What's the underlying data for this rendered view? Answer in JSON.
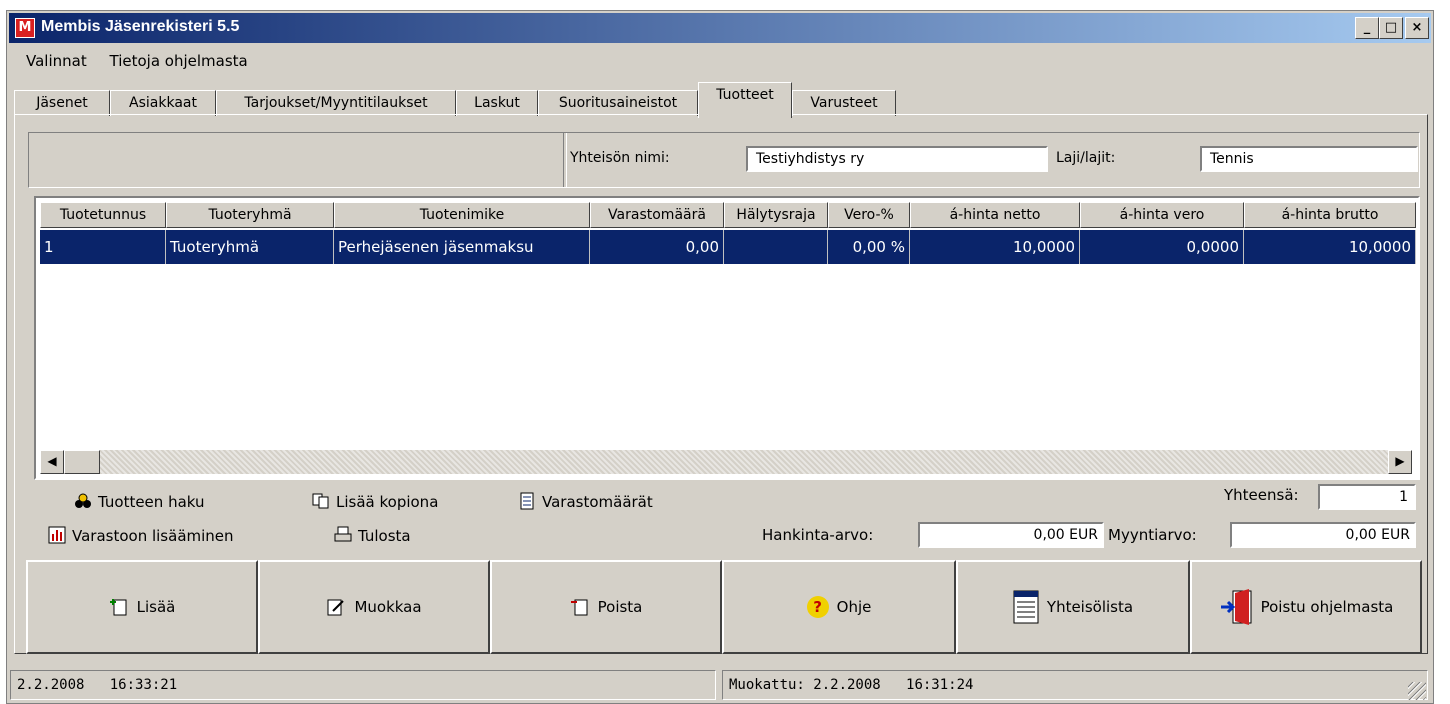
{
  "window": {
    "title": "Membis Jäsenrekisteri 5.5",
    "icon_letter": "M",
    "controls": [
      "_",
      "□",
      "×"
    ]
  },
  "menu": [
    "Valinnat",
    "Tietoja ohjelmasta"
  ],
  "tabs": [
    {
      "label": "Jäsenet"
    },
    {
      "label": "Asiakkaat"
    },
    {
      "label": "Tarjoukset/Myyntitilaukset"
    },
    {
      "label": "Laskut"
    },
    {
      "label": "Suoritusaineistot"
    },
    {
      "label": "Tuotteet",
      "active": true
    },
    {
      "label": "Varusteet"
    }
  ],
  "header": {
    "org_label": "Yhteisön nimi:",
    "org_value": "Testiyhdistys ry",
    "sport_label": "Laji/lajit:",
    "sport_value": "Tennis"
  },
  "grid": {
    "columns": [
      "Tuotetunnus",
      "Tuoteryhmä",
      "Tuotenimike",
      "Varastomäärä",
      "Hälytysraja",
      "Vero-%",
      "á-hinta netto",
      "á-hinta vero",
      "á-hinta brutto"
    ],
    "rows": [
      [
        "1",
        "Tuoteryhmä",
        "Perhejäsenen jäsenmaksu",
        "0,00",
        "",
        "0,00 %",
        "10,0000",
        "0,0000",
        "10,0000"
      ]
    ]
  },
  "actions": {
    "search": "Tuotteen haku",
    "add_copy": "Lisää kopiona",
    "stock": "Varastomäärät",
    "add_stock": "Varastoon lisääminen",
    "print": "Tulosta"
  },
  "totals": {
    "count_label": "Yhteensä:",
    "count_value": "1",
    "purchase_label": "Hankinta-arvo:",
    "purchase_value": "0,00 EUR",
    "sales_label": "Myyntiarvo:",
    "sales_value": "0,00 EUR"
  },
  "buttons": {
    "add": "Lisää",
    "edit": "Muokkaa",
    "delete": "Poista",
    "help": "Ohje",
    "orglist": "Yhteisölista",
    "exit": "Poistu ohjelmasta",
    "help_glyph": "?"
  },
  "status": {
    "date": "2.2.2008",
    "time": "16:33:21",
    "modified": "Muokattu: 2.2.2008",
    "modified_time": "16:31:24"
  },
  "colors": {
    "selection": "#0a246a",
    "face": "#d4d0c8"
  }
}
